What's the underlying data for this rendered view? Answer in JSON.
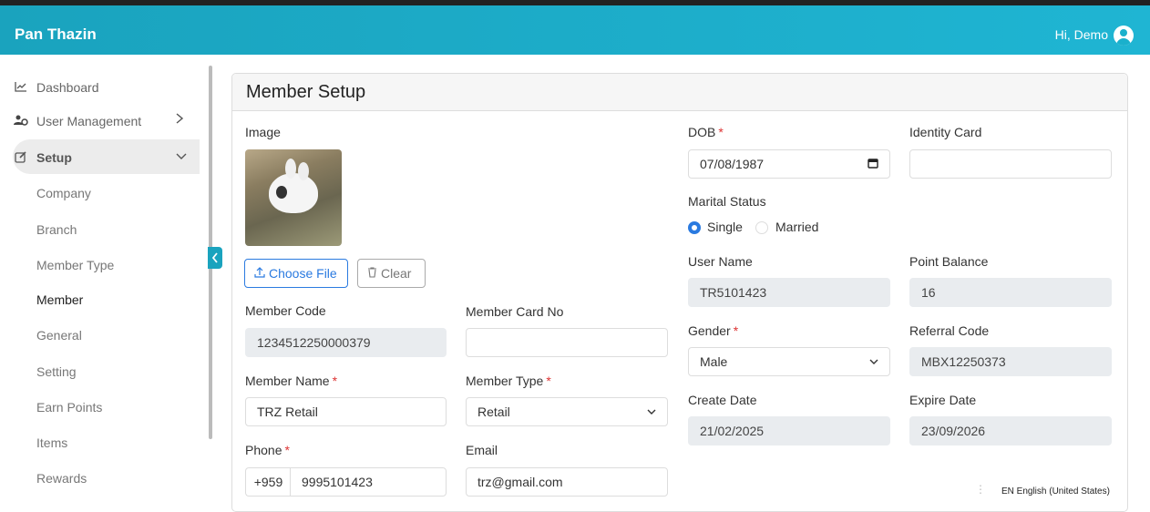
{
  "app": {
    "brand": "Pan Thazin",
    "greeting": "Hi, Demo"
  },
  "sidebar": {
    "items": [
      {
        "label": "Dashboard",
        "icon": "chart-line-icon"
      },
      {
        "label": "User Management",
        "icon": "users-cog-icon"
      },
      {
        "label": "Setup",
        "icon": "edit-icon"
      }
    ],
    "setup_children": [
      "Company",
      "Branch",
      "Member Type",
      "Member",
      "General",
      "Setting",
      "Earn Points",
      "Items",
      "Rewards"
    ],
    "active_child": "Member"
  },
  "page": {
    "title": "Member Setup"
  },
  "form": {
    "image_label": "Image",
    "choose_file": "Choose File",
    "clear": "Clear",
    "member_code": {
      "label": "Member Code",
      "value": "1234512250000379"
    },
    "member_card_no": {
      "label": "Member Card No",
      "value": ""
    },
    "member_name": {
      "label": "Member Name",
      "value": "TRZ Retail"
    },
    "member_type": {
      "label": "Member Type",
      "value": "Retail"
    },
    "phone": {
      "label": "Phone",
      "prefix": "+959",
      "value": "9995101423"
    },
    "email": {
      "label": "Email",
      "value": "trz@gmail.com"
    },
    "dob": {
      "label": "DOB",
      "value": "07/08/1987"
    },
    "identity_card": {
      "label": "Identity Card",
      "value": ""
    },
    "marital_status": {
      "label": "Marital Status",
      "options": [
        "Single",
        "Married"
      ],
      "selected": "Single"
    },
    "user_name": {
      "label": "User Name",
      "value": "TR5101423"
    },
    "point_balance": {
      "label": "Point Balance",
      "value": "16"
    },
    "gender": {
      "label": "Gender",
      "value": "Male"
    },
    "referral_code": {
      "label": "Referral Code",
      "value": "MBX12250373"
    },
    "create_date": {
      "label": "Create Date",
      "value": "21/02/2025"
    },
    "expire_date": {
      "label": "Expire Date",
      "value": "23/09/2026"
    }
  },
  "taskbar": {
    "language": "EN English (United States)"
  },
  "colors": {
    "topbar": "#1aa3be",
    "accent": "#2a7ae0",
    "required": "#d33333"
  }
}
